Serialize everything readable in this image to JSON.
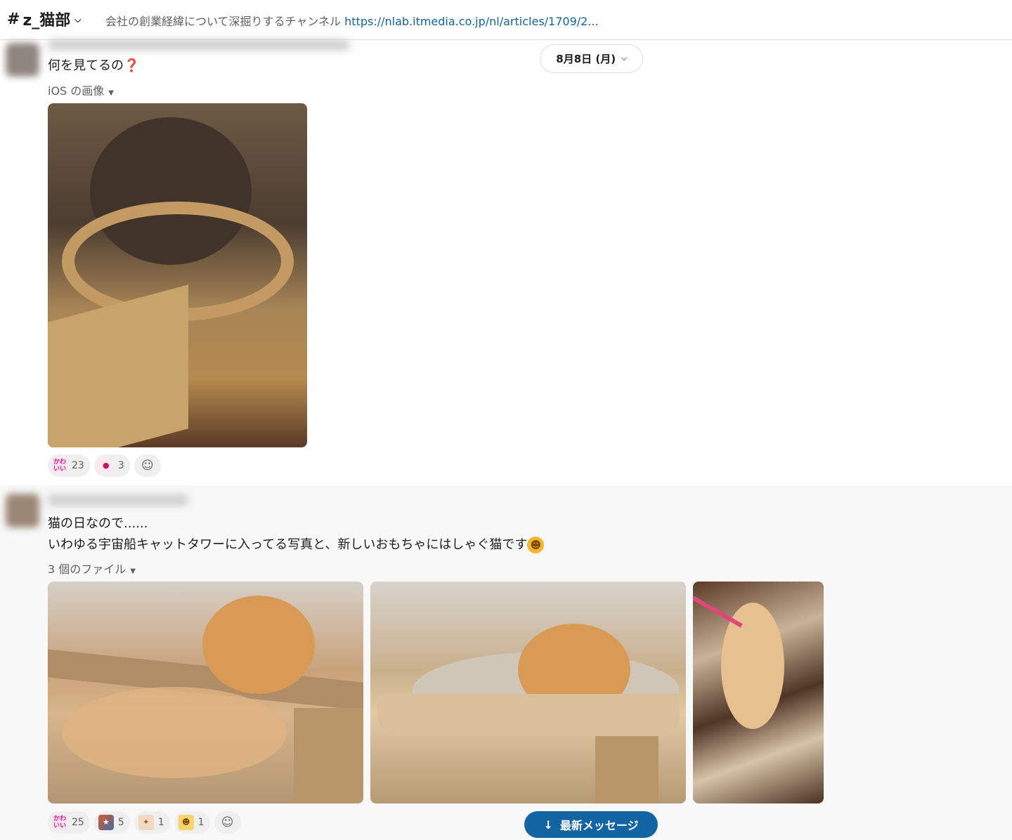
{
  "header": {
    "channel_hash": "#",
    "channel_name": "z_猫部",
    "topic_text": "会社の創業経緯について深掘りするチャンネル ",
    "topic_link": "https://nlab.itmedia.co.jp/nl/articles/1709/2..."
  },
  "date_divider": {
    "label": "8月8日 (月)"
  },
  "messages": [
    {
      "text": "何を見てるの",
      "text_emoji": "❓",
      "files_label": "iOS の画像",
      "reactions": [
        {
          "emoji": "かわいい",
          "count": "23"
        },
        {
          "emoji": "ghost",
          "count": "3"
        }
      ]
    },
    {
      "line1": "猫の日なので......",
      "line2": "いわゆる宇宙船キャットタワーに入ってる写真と、新しいおもちゃにはしゃぐ猫です",
      "files_label": "3 個のファイル",
      "reactions": [
        {
          "emoji": "かわいい",
          "count": "25"
        },
        {
          "emoji": "sticker",
          "count": "5"
        },
        {
          "emoji": "clap",
          "count": "1"
        },
        {
          "emoji": "cat",
          "count": "1"
        }
      ]
    }
  ],
  "jump_button": {
    "label": "最新メッセージ"
  },
  "colors": {
    "accent": "#1264a3",
    "hover_bg": "#f8f8f8",
    "text": "#1d1c1d",
    "muted": "#616061"
  }
}
